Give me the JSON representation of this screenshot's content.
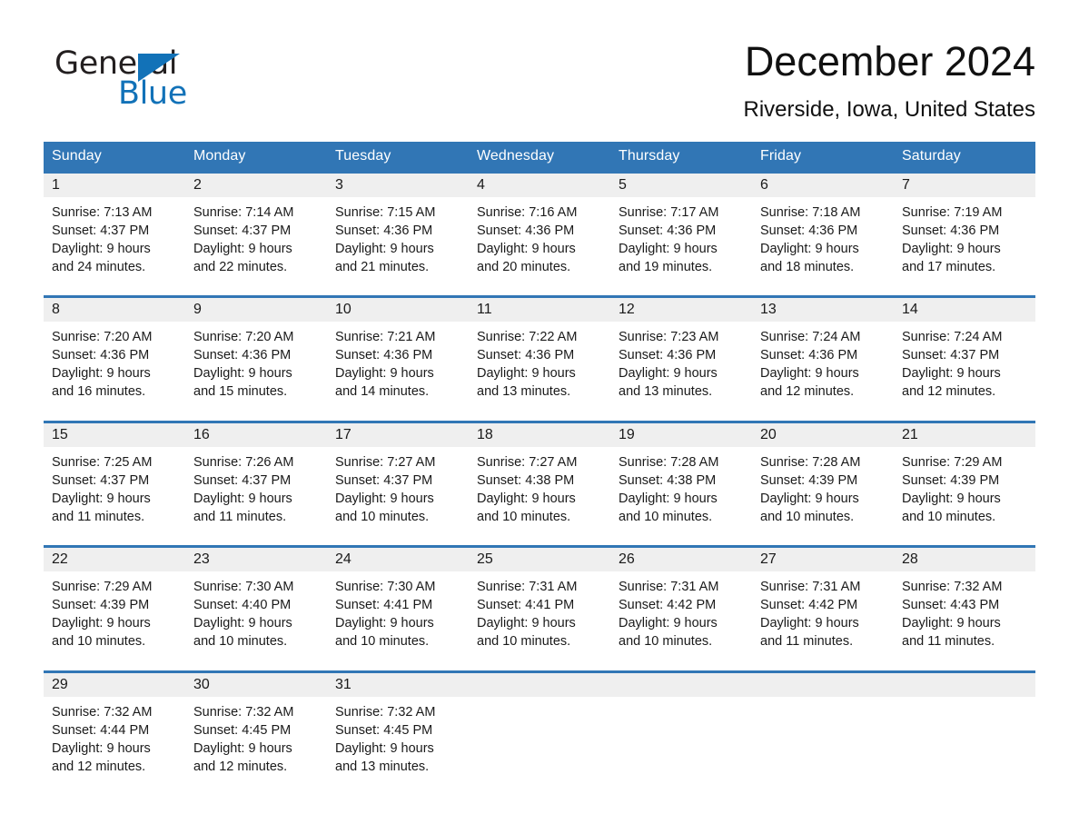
{
  "brand": {
    "word1": "General",
    "word2": "Blue",
    "triangle_color": "#1272b8"
  },
  "header": {
    "month_title": "December 2024",
    "location": "Riverside, Iowa, United States"
  },
  "theme": {
    "header_blue": "#3176b5",
    "date_band_gray": "#efefef",
    "text": "#1a1a1a"
  },
  "calendar": {
    "weekday_headers": [
      "Sunday",
      "Monday",
      "Tuesday",
      "Wednesday",
      "Thursday",
      "Friday",
      "Saturday"
    ],
    "weeks": [
      {
        "dates": [
          "1",
          "2",
          "3",
          "4",
          "5",
          "6",
          "7"
        ],
        "info": [
          "Sunrise: 7:13 AM\nSunset: 4:37 PM\nDaylight: 9 hours\nand 24 minutes.",
          "Sunrise: 7:14 AM\nSunset: 4:37 PM\nDaylight: 9 hours\nand 22 minutes.",
          "Sunrise: 7:15 AM\nSunset: 4:36 PM\nDaylight: 9 hours\nand 21 minutes.",
          "Sunrise: 7:16 AM\nSunset: 4:36 PM\nDaylight: 9 hours\nand 20 minutes.",
          "Sunrise: 7:17 AM\nSunset: 4:36 PM\nDaylight: 9 hours\nand 19 minutes.",
          "Sunrise: 7:18 AM\nSunset: 4:36 PM\nDaylight: 9 hours\nand 18 minutes.",
          "Sunrise: 7:19 AM\nSunset: 4:36 PM\nDaylight: 9 hours\nand 17 minutes."
        ]
      },
      {
        "dates": [
          "8",
          "9",
          "10",
          "11",
          "12",
          "13",
          "14"
        ],
        "info": [
          "Sunrise: 7:20 AM\nSunset: 4:36 PM\nDaylight: 9 hours\nand 16 minutes.",
          "Sunrise: 7:20 AM\nSunset: 4:36 PM\nDaylight: 9 hours\nand 15 minutes.",
          "Sunrise: 7:21 AM\nSunset: 4:36 PM\nDaylight: 9 hours\nand 14 minutes.",
          "Sunrise: 7:22 AM\nSunset: 4:36 PM\nDaylight: 9 hours\nand 13 minutes.",
          "Sunrise: 7:23 AM\nSunset: 4:36 PM\nDaylight: 9 hours\nand 13 minutes.",
          "Sunrise: 7:24 AM\nSunset: 4:36 PM\nDaylight: 9 hours\nand 12 minutes.",
          "Sunrise: 7:24 AM\nSunset: 4:37 PM\nDaylight: 9 hours\nand 12 minutes."
        ]
      },
      {
        "dates": [
          "15",
          "16",
          "17",
          "18",
          "19",
          "20",
          "21"
        ],
        "info": [
          "Sunrise: 7:25 AM\nSunset: 4:37 PM\nDaylight: 9 hours\nand 11 minutes.",
          "Sunrise: 7:26 AM\nSunset: 4:37 PM\nDaylight: 9 hours\nand 11 minutes.",
          "Sunrise: 7:27 AM\nSunset: 4:37 PM\nDaylight: 9 hours\nand 10 minutes.",
          "Sunrise: 7:27 AM\nSunset: 4:38 PM\nDaylight: 9 hours\nand 10 minutes.",
          "Sunrise: 7:28 AM\nSunset: 4:38 PM\nDaylight: 9 hours\nand 10 minutes.",
          "Sunrise: 7:28 AM\nSunset: 4:39 PM\nDaylight: 9 hours\nand 10 minutes.",
          "Sunrise: 7:29 AM\nSunset: 4:39 PM\nDaylight: 9 hours\nand 10 minutes."
        ]
      },
      {
        "dates": [
          "22",
          "23",
          "24",
          "25",
          "26",
          "27",
          "28"
        ],
        "info": [
          "Sunrise: 7:29 AM\nSunset: 4:39 PM\nDaylight: 9 hours\nand 10 minutes.",
          "Sunrise: 7:30 AM\nSunset: 4:40 PM\nDaylight: 9 hours\nand 10 minutes.",
          "Sunrise: 7:30 AM\nSunset: 4:41 PM\nDaylight: 9 hours\nand 10 minutes.",
          "Sunrise: 7:31 AM\nSunset: 4:41 PM\nDaylight: 9 hours\nand 10 minutes.",
          "Sunrise: 7:31 AM\nSunset: 4:42 PM\nDaylight: 9 hours\nand 10 minutes.",
          "Sunrise: 7:31 AM\nSunset: 4:42 PM\nDaylight: 9 hours\nand 11 minutes.",
          "Sunrise: 7:32 AM\nSunset: 4:43 PM\nDaylight: 9 hours\nand 11 minutes."
        ]
      },
      {
        "dates": [
          "29",
          "30",
          "31",
          "",
          "",
          "",
          ""
        ],
        "info": [
          "Sunrise: 7:32 AM\nSunset: 4:44 PM\nDaylight: 9 hours\nand 12 minutes.",
          "Sunrise: 7:32 AM\nSunset: 4:45 PM\nDaylight: 9 hours\nand 12 minutes.",
          "Sunrise: 7:32 AM\nSunset: 4:45 PM\nDaylight: 9 hours\nand 13 minutes.",
          "",
          "",
          "",
          ""
        ]
      }
    ]
  }
}
